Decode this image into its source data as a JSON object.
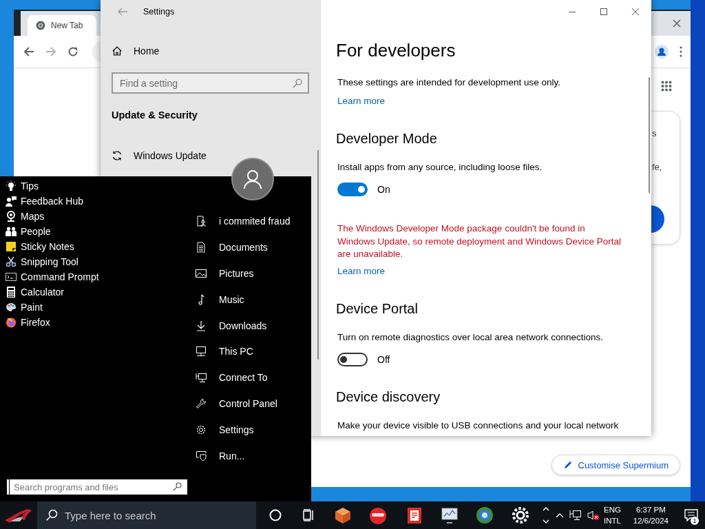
{
  "browser": {
    "tab_title": "New Tab",
    "card_texts": [
      "s",
      "fe,"
    ],
    "customise_button": "Customise Supermium"
  },
  "settings": {
    "title": "Settings",
    "home": "Home",
    "search": {
      "placeholder": "Find a setting"
    },
    "section": "Update & Security",
    "nav_items": [
      "Windows Update"
    ],
    "page_title": "For developers",
    "blocks": [
      {
        "kind": "text",
        "text": "These settings are intended for development use only."
      },
      {
        "kind": "link",
        "text": "Learn more"
      },
      {
        "kind": "heading",
        "text": "Developer Mode"
      },
      {
        "kind": "text",
        "text": "Install apps from any source, including loose files."
      },
      {
        "kind": "toggle",
        "on": true,
        "label": "On"
      },
      {
        "kind": "error",
        "text": "The Windows Developer Mode package couldn't be found in Windows Update, so remote deployment and Windows Device Portal are unavailable."
      },
      {
        "kind": "link",
        "text": "Learn more"
      },
      {
        "kind": "heading",
        "text": "Device Portal"
      },
      {
        "kind": "text",
        "text": "Turn on remote diagnostics over local area network connections."
      },
      {
        "kind": "toggle",
        "on": false,
        "label": "Off"
      },
      {
        "kind": "heading",
        "text": "Device discovery"
      },
      {
        "kind": "text",
        "text": "Make your device visible to USB connections and your local network"
      }
    ]
  },
  "start_menu": {
    "apps": [
      "Tips",
      "Feedback Hub",
      "Maps",
      "People",
      "Sticky Notes",
      "Snipping Tool",
      "Command Prompt",
      "Calculator",
      "Paint",
      "Firefox"
    ],
    "places": [
      "i commited fraud",
      "Documents",
      "Pictures",
      "Music",
      "Downloads",
      "This PC",
      "Connect To",
      "Control Panel",
      "Settings",
      "Run..."
    ],
    "search": {
      "placeholder": "Search programs and files"
    }
  },
  "taskbar": {
    "search": {
      "placeholder": "Type here to search"
    },
    "language": "ENG",
    "layout": "INTL",
    "time": "6:37 PM",
    "date": "12/6/2024",
    "notifications": "1"
  }
}
